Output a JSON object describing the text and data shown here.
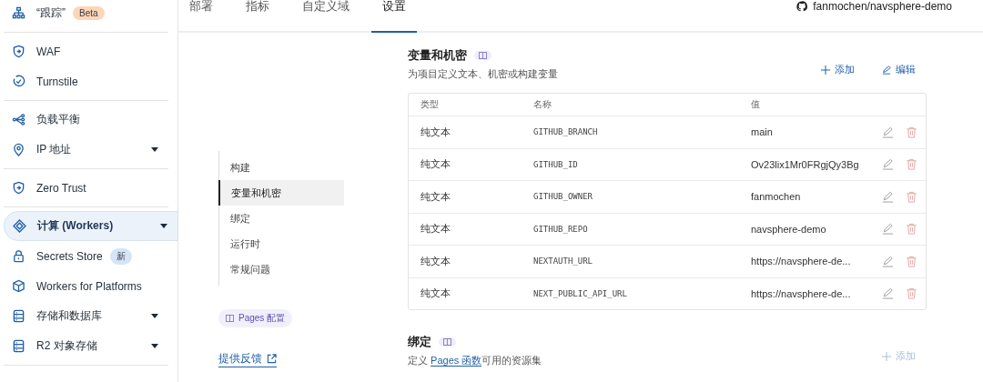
{
  "sidebar": {
    "groups": [
      {
        "items": [
          {
            "label": "“跟踪”",
            "badge": {
              "label": "Beta",
              "color": "#fbd6b8"
            },
            "expandable": false,
            "selected": false
          }
        ]
      },
      {
        "items": [
          {
            "label": "WAF",
            "expandable": false,
            "selected": false
          },
          {
            "label": "Turnstile",
            "expandable": false,
            "selected": false
          }
        ]
      },
      {
        "items": [
          {
            "label": "负载平衡",
            "expandable": false,
            "selected": false
          },
          {
            "label": "IP 地址",
            "expandable": true,
            "selected": false
          }
        ]
      },
      {
        "items": [
          {
            "label": "Zero Trust",
            "expandable": false,
            "selected": false
          }
        ]
      },
      {
        "items": [
          {
            "label": "计算 (Workers)",
            "expandable": true,
            "selected": true
          },
          {
            "label": "Secrets Store",
            "badge": {
              "label": "新",
              "color": "#d6e4f7"
            },
            "expandable": false,
            "selected": false
          },
          {
            "label": "Workers for Platforms",
            "expandable": false,
            "selected": false
          },
          {
            "label": "存储和数据库",
            "expandable": true,
            "selected": false
          },
          {
            "label": "R2 对象存储",
            "expandable": true,
            "selected": false
          }
        ]
      }
    ]
  },
  "tabs": [
    {
      "label": "部署",
      "selected": false
    },
    {
      "label": "指标",
      "selected": false
    },
    {
      "label": "自定义域",
      "selected": false
    },
    {
      "label": "设置",
      "selected": true
    }
  ],
  "repo": "fanmochen/navsphere-demo",
  "settings_nav": {
    "items": [
      {
        "label": "构建",
        "selected": false
      },
      {
        "label": "变量和机密",
        "selected": true
      },
      {
        "label": "绑定",
        "selected": false
      },
      {
        "label": "运行时",
        "selected": false
      },
      {
        "label": "常规问题",
        "selected": false
      }
    ],
    "docs_badge": "Pages 配置",
    "feedback_link": "提供反馈"
  },
  "variables": {
    "title": "变量和机密",
    "subtitle": "为项目定义文本、机密或构建变量",
    "add": "添加",
    "edit": "编辑",
    "columns": [
      "类型",
      "名称",
      "值"
    ],
    "rows": [
      {
        "type": "纯文本",
        "name": "GITHUB_BRANCH",
        "value": "main"
      },
      {
        "type": "纯文本",
        "name": "GITHUB_ID",
        "value": "Ov23lix1Mr0FRgjQy3Bg"
      },
      {
        "type": "纯文本",
        "name": "GITHUB_OWNER",
        "value": "fanmochen"
      },
      {
        "type": "纯文本",
        "name": "GITHUB_REPO",
        "value": "navsphere-demo"
      },
      {
        "type": "纯文本",
        "name": "NEXTAUTH_URL",
        "value": "https://navsphere-de..."
      },
      {
        "type": "纯文本",
        "name": "NEXT_PUBLIC_API_URL",
        "value": "https://navsphere-de..."
      }
    ]
  },
  "bindings": {
    "title": "绑定",
    "subtitle_before": "定义 ",
    "subtitle_link": "Pages 函数",
    "subtitle_after": "可用的资源集",
    "add": "添加",
    "add_disabled": true
  }
}
